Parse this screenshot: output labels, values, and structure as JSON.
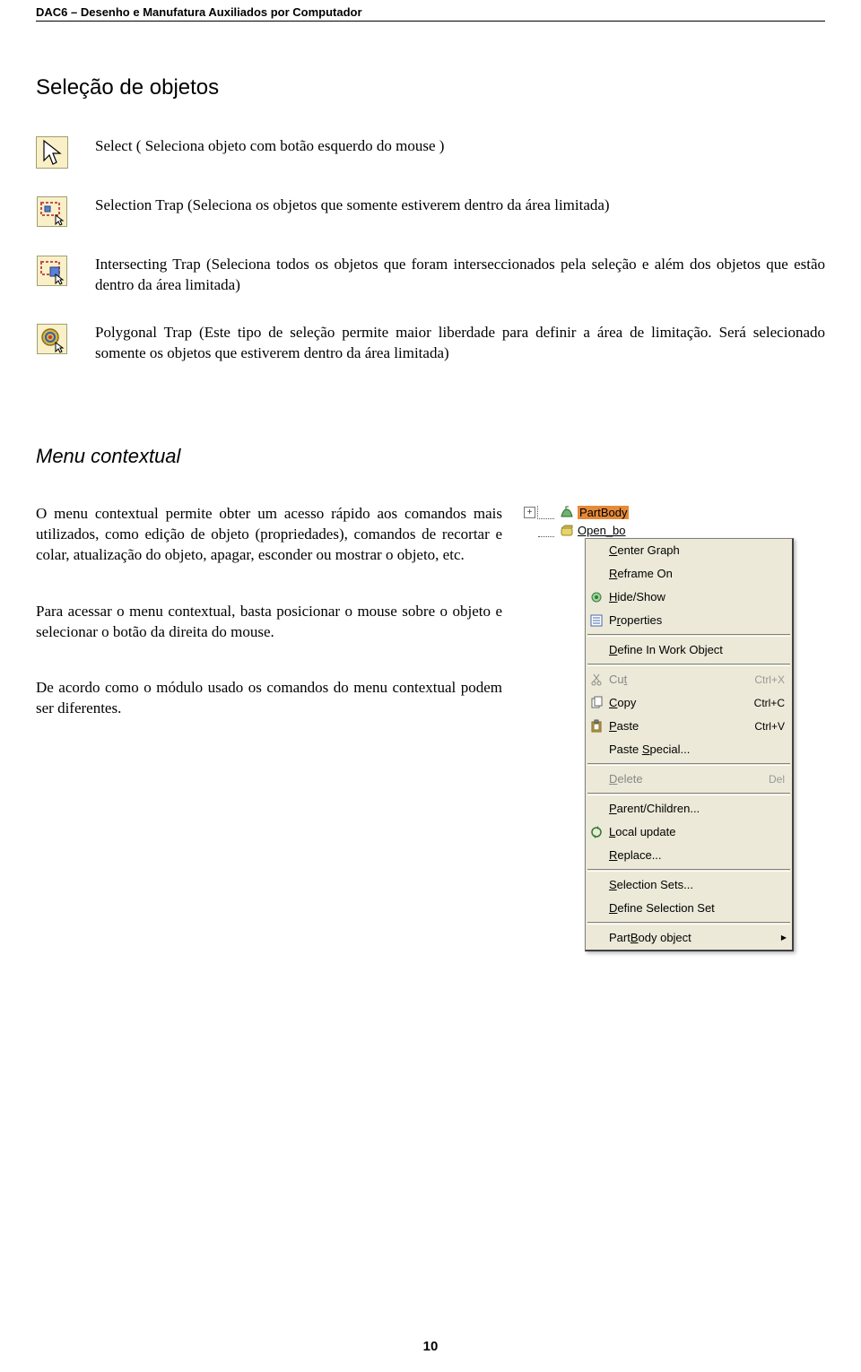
{
  "header": {
    "title": "DAC6 – Desenho e Manufatura Auxiliados por Computador"
  },
  "section1": {
    "title": "Seleção de objetos",
    "tools": [
      {
        "text": "Select ( Seleciona objeto com botão esquerdo do mouse )"
      },
      {
        "text": "Selection Trap (Seleciona os objetos que somente estiverem dentro da área limitada)"
      },
      {
        "text": "Intersecting Trap (Seleciona todos os objetos que foram interseccionados pela seleção e além dos objetos que estão dentro da área limitada)"
      },
      {
        "text": "Polygonal Trap  (Este tipo de seleção permite maior liberdade para definir a área de limitação. Será selecionado somente os objetos que estiverem dentro da área limitada)"
      }
    ]
  },
  "section2": {
    "title": "Menu contextual",
    "p1": "O menu contextual permite obter um acesso rápido aos comandos mais utilizados, como edição de objeto (propriedades), comandos de recortar e colar, atualização do objeto, apagar, esconder ou mostrar o objeto, etc.",
    "p2": "Para acessar o menu contextual, basta posicionar o mouse sobre o objeto e selecionar o botão da direita do mouse.",
    "p3": "De acordo como o módulo usado os comandos do menu contextual podem ser diferentes."
  },
  "tree": {
    "partbody": "PartBody",
    "openbody": "Open_bo"
  },
  "menu": {
    "items": [
      {
        "label": "Center Graph",
        "icon": null,
        "shortcut": ""
      },
      {
        "label": "Reframe On",
        "icon": null,
        "shortcut": ""
      },
      {
        "label": "Hide/Show",
        "icon": "hideshow",
        "shortcut": ""
      },
      {
        "label": "Properties",
        "icon": "properties",
        "shortcut": ""
      },
      {
        "sep": true
      },
      {
        "label": "Define In Work Object",
        "icon": null,
        "shortcut": ""
      },
      {
        "sep": true
      },
      {
        "label": "Cut",
        "icon": "cut",
        "shortcut": "Ctrl+X",
        "disabled": true
      },
      {
        "label": "Copy",
        "icon": "copy",
        "shortcut": "Ctrl+C"
      },
      {
        "label": "Paste",
        "icon": "paste",
        "shortcut": "Ctrl+V"
      },
      {
        "label": "Paste Special...",
        "icon": null,
        "shortcut": ""
      },
      {
        "sep": true
      },
      {
        "label": "Delete",
        "icon": null,
        "shortcut": "Del",
        "disabled": true
      },
      {
        "sep": true
      },
      {
        "label": "Parent/Children...",
        "icon": null,
        "shortcut": ""
      },
      {
        "label": "Local update",
        "icon": "update",
        "shortcut": ""
      },
      {
        "label": "Replace...",
        "icon": null,
        "shortcut": ""
      },
      {
        "sep": true
      },
      {
        "label": "Selection Sets...",
        "icon": null,
        "shortcut": ""
      },
      {
        "label": "Define Selection Set",
        "icon": null,
        "shortcut": ""
      },
      {
        "sep": true
      },
      {
        "label": "PartBody object",
        "icon": null,
        "shortcut": "",
        "arrow": true
      }
    ]
  },
  "footer": {
    "page": "10"
  }
}
